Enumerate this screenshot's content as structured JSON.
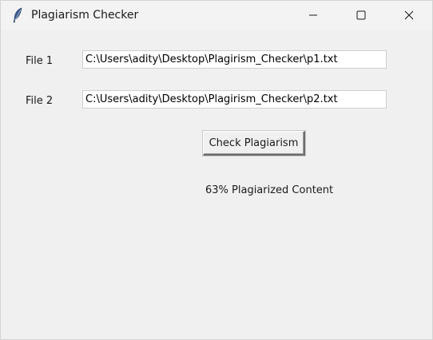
{
  "window": {
    "title": "Plagiarism Checker",
    "app_icon": "feather-icon",
    "controls": [
      "minimize-icon",
      "maximize-icon",
      "close-icon"
    ]
  },
  "form": {
    "file1_label": "File 1",
    "file1_value": "C:\\Users\\adity\\Desktop\\Plagirism_Checker\\p1.txt",
    "file2_label": "File 2",
    "file2_value": "C:\\Users\\adity\\Desktop\\Plagirism_Checker\\p2.txt",
    "check_button_label": "Check Plagiarism",
    "result_text": "63% Plagiarized Content"
  },
  "colors": {
    "background": "#f0f0f0",
    "entry_background": "#ffffff",
    "text": "#1a1a1a"
  }
}
